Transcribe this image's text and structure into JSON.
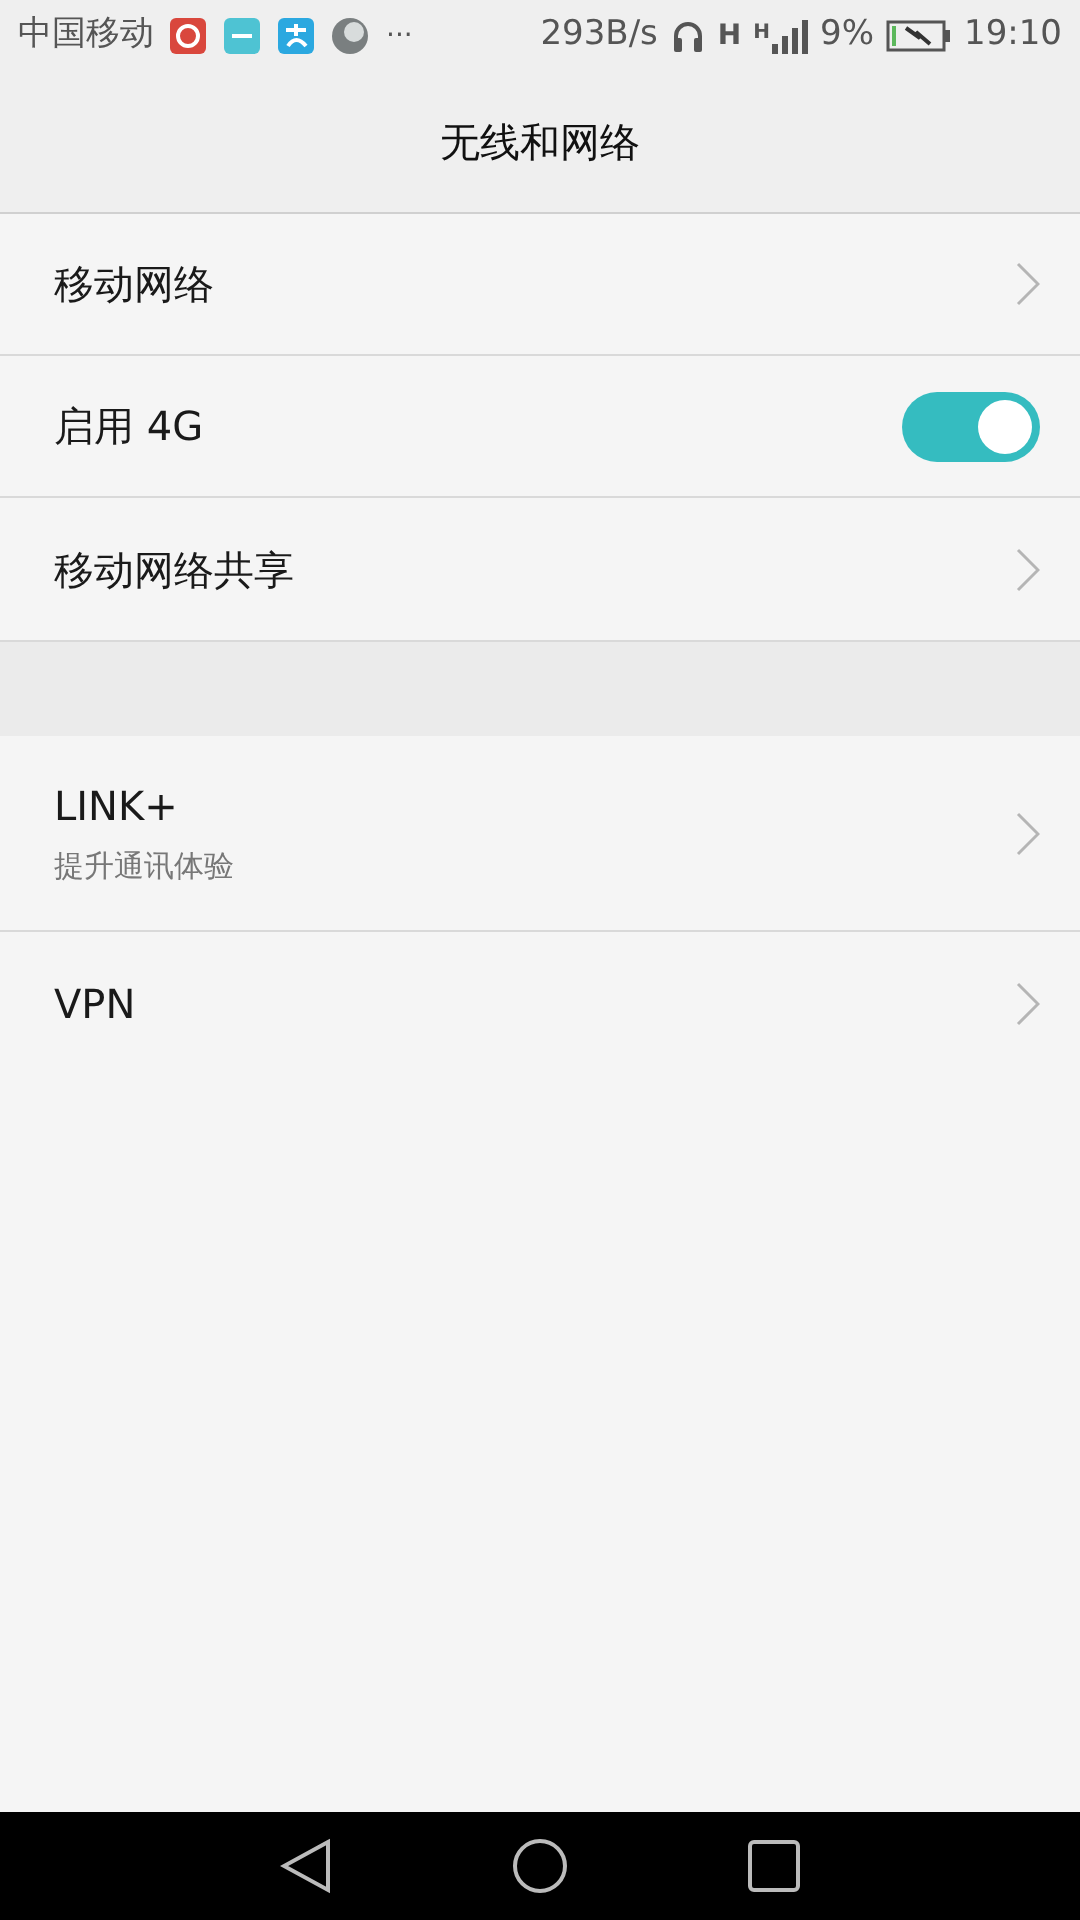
{
  "status_bar": {
    "carrier": "中国移动",
    "more": "···",
    "speed": "293B/s",
    "network_labels": [
      "H",
      "H"
    ],
    "battery": "9%",
    "time": "19:10"
  },
  "title": "无线和网络",
  "sections": [
    {
      "items": [
        {
          "kind": "link",
          "label": "移动网络"
        },
        {
          "kind": "toggle",
          "label": "启用 4G",
          "on": true
        },
        {
          "kind": "link",
          "label": "移动网络共享"
        }
      ]
    },
    {
      "items": [
        {
          "kind": "link",
          "label": "LINK+",
          "subtitle": "提升通讯体验"
        },
        {
          "kind": "link",
          "label": "VPN"
        }
      ]
    }
  ]
}
